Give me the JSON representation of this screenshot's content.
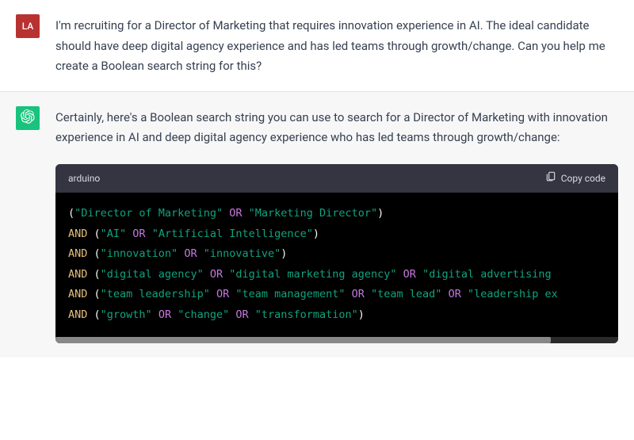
{
  "user": {
    "avatar_initials": "LA",
    "message": "I'm recruiting for a Director of Marketing that requires innovation experience in AI. The ideal candidate should have deep digital agency experience and has led teams through growth/change. Can you help me create a Boolean search string for this?"
  },
  "assistant": {
    "intro": "Certainly, here's a Boolean search string you can use to search for a Director of Marketing with innovation experience in AI and deep digital agency experience who has led teams through growth/change:",
    "code": {
      "language": "arduino",
      "copy_label": "Copy code",
      "tokens": [
        [
          [
            "paren",
            "("
          ],
          [
            "str",
            "\"Director of Marketing\""
          ],
          [
            "or",
            " OR "
          ],
          [
            "str",
            "\"Marketing Director\""
          ],
          [
            "paren",
            ")"
          ]
        ],
        [
          [
            "and",
            "AND "
          ],
          [
            "paren",
            "("
          ],
          [
            "str",
            "\"AI\""
          ],
          [
            "or",
            " OR "
          ],
          [
            "str",
            "\"Artificial Intelligence\""
          ],
          [
            "paren",
            ")"
          ]
        ],
        [
          [
            "and",
            "AND "
          ],
          [
            "paren",
            "("
          ],
          [
            "str",
            "\"innovation\""
          ],
          [
            "or",
            " OR "
          ],
          [
            "str",
            "\"innovative\""
          ],
          [
            "paren",
            ")"
          ]
        ],
        [
          [
            "and",
            "AND "
          ],
          [
            "paren",
            "("
          ],
          [
            "str",
            "\"digital agency\""
          ],
          [
            "or",
            " OR "
          ],
          [
            "str",
            "\"digital marketing agency\""
          ],
          [
            "or",
            " OR "
          ],
          [
            "str",
            "\"digital advertising "
          ]
        ],
        [
          [
            "and",
            "AND "
          ],
          [
            "paren",
            "("
          ],
          [
            "str",
            "\"team leadership\""
          ],
          [
            "or",
            " OR "
          ],
          [
            "str",
            "\"team management\""
          ],
          [
            "or",
            " OR "
          ],
          [
            "str",
            "\"team lead\""
          ],
          [
            "or",
            " OR "
          ],
          [
            "str",
            "\"leadership ex"
          ]
        ],
        [
          [
            "and",
            "AND "
          ],
          [
            "paren",
            "("
          ],
          [
            "str",
            "\"growth\""
          ],
          [
            "or",
            " OR "
          ],
          [
            "str",
            "\"change\""
          ],
          [
            "or",
            " OR "
          ],
          [
            "str",
            "\"transformation\""
          ],
          [
            "paren",
            ")"
          ]
        ]
      ]
    }
  }
}
